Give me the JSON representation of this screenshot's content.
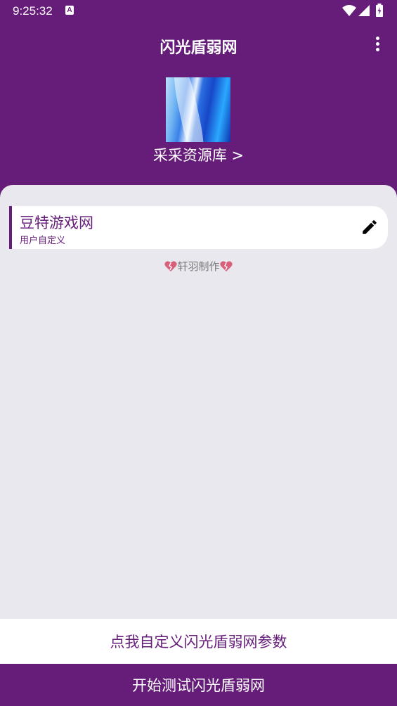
{
  "status_bar": {
    "time": "9:25:32",
    "notification_letter": "A",
    "icons": [
      "wifi-icon",
      "signal-icon",
      "battery-icon"
    ]
  },
  "app_bar": {
    "title": "闪光盾弱网",
    "menu_icon": "more-vert-icon"
  },
  "resource": {
    "link_label": "采采资源库 >"
  },
  "site_card": {
    "name": "豆特游戏网",
    "subtitle": "用户自定义",
    "edit_icon": "pencil-icon"
  },
  "credit": {
    "text": "轩羽制作",
    "icon": "broken-heart-icon"
  },
  "buttons": {
    "customize_label": "点我自定义闪光盾弱网参数",
    "start_label": "开始测试闪光盾弱网"
  },
  "colors": {
    "primary": "#661c79",
    "background": "#e8e8ee",
    "card": "#ffffff"
  }
}
